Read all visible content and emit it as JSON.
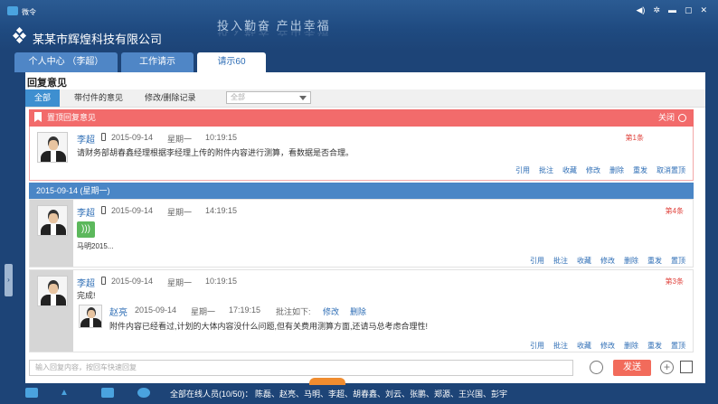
{
  "window": {
    "app_name": "微令",
    "company": "某某市辉煌科技有限公司",
    "slogan": "投入勤奋  产出幸福"
  },
  "tabs": [
    {
      "label": "个人中心  （李超）"
    },
    {
      "label": "工作请示"
    },
    {
      "label": "请示60"
    }
  ],
  "section_title": "回复意见",
  "subtabs": {
    "all": "全部",
    "attached": "带付件的意见",
    "edit_log": "修改/删除记录",
    "filter_value": "全部"
  },
  "pinned": {
    "bar_label": "置顶回复意见",
    "close_label": "关闭",
    "message": {
      "name": "李超",
      "date": "2015-09-14",
      "weekday": "星期一",
      "time": "10:19:15",
      "floor": "第1条",
      "text": "请财务部胡春鑫经理根据李经理上传的附件内容进行测算，看数据是否合理。",
      "actions": [
        "引用",
        "批注",
        "收藏",
        "修改",
        "删除",
        "重发",
        "取消置顶"
      ]
    }
  },
  "date_header": "2015-09-14 (星期一)",
  "messages": [
    {
      "name": "李超",
      "date": "2015-09-14",
      "weekday": "星期一",
      "time": "14:19:15",
      "floor": "第4条",
      "voice_caption": "马明2015...",
      "actions": [
        "引用",
        "批注",
        "收藏",
        "修改",
        "删除",
        "重发",
        "置顶"
      ]
    },
    {
      "name": "李超",
      "date": "2015-09-14",
      "weekday": "星期一",
      "time": "10:19:15",
      "floor": "第3条",
      "text": "完成!",
      "annotation": {
        "name": "赵亮",
        "date": "2015-09-14",
        "weekday": "星期一",
        "time": "17:19:15",
        "label": "批注如下:",
        "edit": "修改",
        "delete": "删除",
        "text": "附件内容已经看过,计划的大体内容没什么问题,但有关费用测算方面,还请马总考虑合理性!"
      },
      "actions": [
        "引用",
        "批注",
        "收藏",
        "修改",
        "删除",
        "重发",
        "置顶"
      ]
    }
  ],
  "composer": {
    "placeholder": "输入回复内容，按回车快速回复",
    "send_label": "发送"
  },
  "footer": {
    "online_text": "全部在线人员(10/50)：  陈磊、赵亮、马明、李超、胡春鑫、刘云、张鹏、郑源、王兴国、彭宇"
  },
  "colors": {
    "brand": "#1d4477",
    "accent": "#2d6db5",
    "pin": "#f26b6b",
    "send": "#f26b5b"
  }
}
